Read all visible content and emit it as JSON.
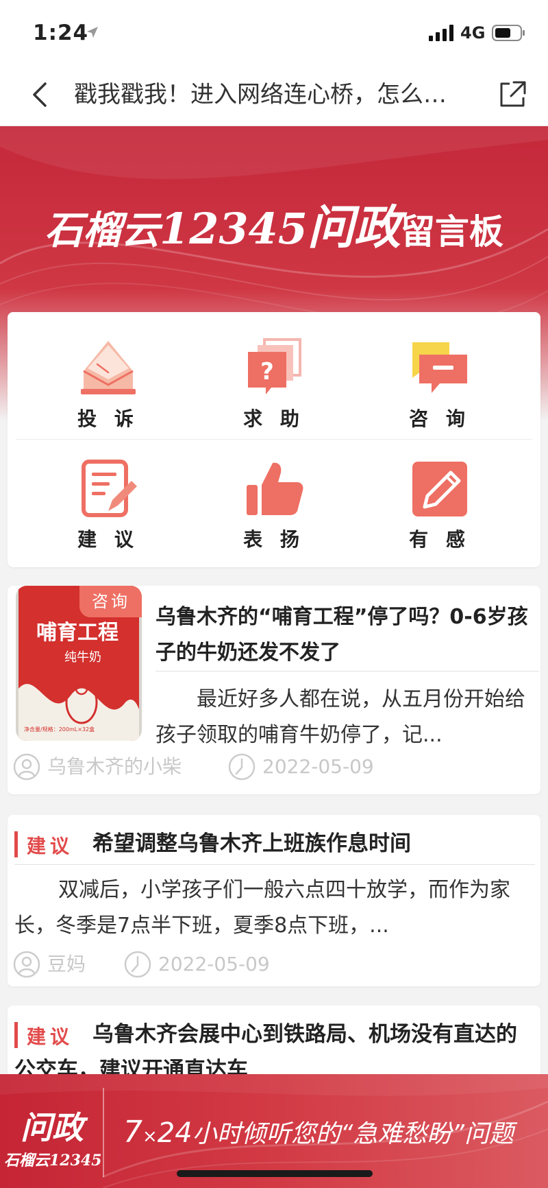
{
  "status_bar": {
    "time": "1:24",
    "network": "4G"
  },
  "nav": {
    "title": "戳我戳我！进入网络连心桥，怎么…"
  },
  "hero": {
    "brand": "石榴云",
    "number": "12345",
    "wenzheng": "问政",
    "board": "留言板"
  },
  "categories": [
    {
      "label": "投 诉",
      "icon": "envelope-icon"
    },
    {
      "label": "求 助",
      "icon": "question-icon"
    },
    {
      "label": "咨 询",
      "icon": "chat-bubble-icon"
    },
    {
      "label": "建 议",
      "icon": "document-pen-icon"
    },
    {
      "label": "表 扬",
      "icon": "thumbs-up-icon"
    },
    {
      "label": "有 感",
      "icon": "pencil-icon"
    }
  ],
  "posts": [
    {
      "tag": "咨询",
      "title": "乌鲁木齐的“哺育工程”停了吗？0-6岁孩子的牛奶还发不发了",
      "summary": "最近好多人都在说，从五月份开始给孩子领取的哺育牛奶停了，记...",
      "author": "乌鲁木齐的小柴",
      "date": "2022-05-09",
      "image": {
        "line1": "哺育工程",
        "line2": "纯牛奶",
        "fine": "净含量/规格：200mL×32盒"
      }
    },
    {
      "tag": "建议",
      "title": "希望调整乌鲁木齐上班族作息时间",
      "summary": "双减后，小学孩子们一般六点四十放学，而作为家长，冬季是7点半下班，夏季8点下班，...",
      "author": "豆妈",
      "date": "2022-05-09"
    },
    {
      "tag": "建议",
      "title": "乌鲁木齐会展中心到铁路局、机场没有直达的公交车，建议开通直达车"
    }
  ],
  "banner": {
    "logo_top": "问政",
    "logo_bottom": "石榴云12345",
    "slogan_prefix": "7",
    "slogan_x": "×",
    "slogan_num": "24",
    "slogan_text": "小时倾听您的“急难愁盼”问题"
  },
  "colors": {
    "brand_red": "#c4283a",
    "tag_red": "#e24b4b",
    "icon_orange": "#ee6f63",
    "meta_gray": "#c8c8c8"
  }
}
